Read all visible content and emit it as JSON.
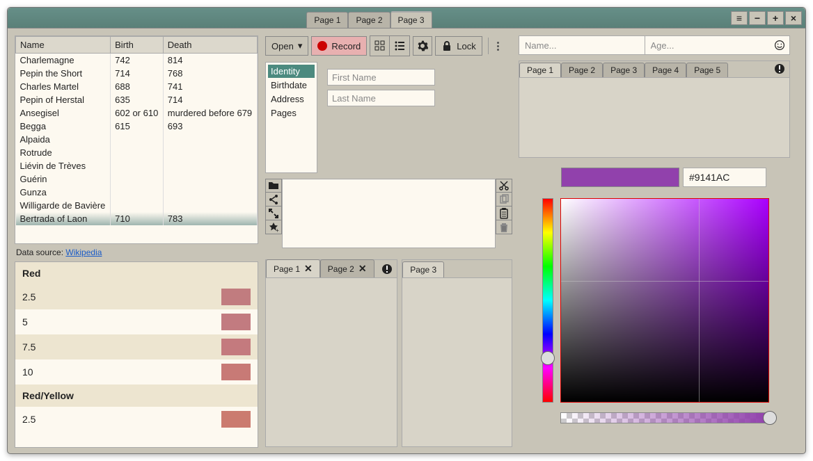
{
  "titlebar": {
    "tabs": [
      "Page 1",
      "Page 2",
      "Page 3"
    ],
    "active": 2
  },
  "table": {
    "headers": [
      "Name",
      "Birth",
      "Death"
    ],
    "rows": [
      [
        "Charlemagne",
        "742",
        "814"
      ],
      [
        "Pepin the Short",
        "714",
        "768"
      ],
      [
        "Charles Martel",
        "688",
        "741"
      ],
      [
        "Pepin of Herstal",
        "635",
        "714"
      ],
      [
        "Ansegisel",
        "602 or 610",
        "murdered before 679"
      ],
      [
        "Begga",
        "615",
        "693"
      ],
      [
        "Alpaida",
        "",
        ""
      ],
      [
        "Rotrude",
        "",
        ""
      ],
      [
        "Liévin de Trèves",
        "",
        ""
      ],
      [
        "Guérin",
        "",
        ""
      ],
      [
        "Gunza",
        "",
        ""
      ],
      [
        "Willigarde de Bavière",
        "",
        ""
      ],
      [
        "Bertrada of Laon",
        "710",
        "783"
      ]
    ],
    "source_label": "Data source:",
    "source_link": "Wikipedia"
  },
  "color_list": {
    "groups": [
      {
        "title": "Red",
        "rows": [
          {
            "label": "2.5",
            "color": "#c17c7f"
          },
          {
            "label": "5",
            "color": "#c27b80"
          },
          {
            "label": "7.5",
            "color": "#c47a7e"
          },
          {
            "label": "10",
            "color": "#c87a76"
          }
        ]
      },
      {
        "title": "Red/Yellow",
        "rows": [
          {
            "label": "2.5",
            "color": "#cb7b6f"
          }
        ]
      }
    ]
  },
  "toolbar": {
    "open": "Open",
    "record": "Record",
    "lock": "Lock"
  },
  "identity": {
    "tabs": [
      "Identity",
      "Birthdate",
      "Address",
      "Pages"
    ],
    "active": 0,
    "first_name_ph": "First Name",
    "last_name_ph": "Last Name"
  },
  "bottom_pages": {
    "group1": [
      "Page 1",
      "Page 2"
    ],
    "group1_active": 0,
    "group2": [
      "Page 3"
    ]
  },
  "search": {
    "name_ph": "Name...",
    "age_ph": "Age..."
  },
  "right_pages": {
    "tabs": [
      "Page 1",
      "Page 2",
      "Page 3",
      "Page 4",
      "Page 5"
    ],
    "active": 0
  },
  "color_picker": {
    "hex": "#9141AC",
    "preview": "#9141AC",
    "hue_pos": 0.78,
    "sv_x": 0.66,
    "sv_y": 0.4,
    "alpha_pos": 1.0
  }
}
